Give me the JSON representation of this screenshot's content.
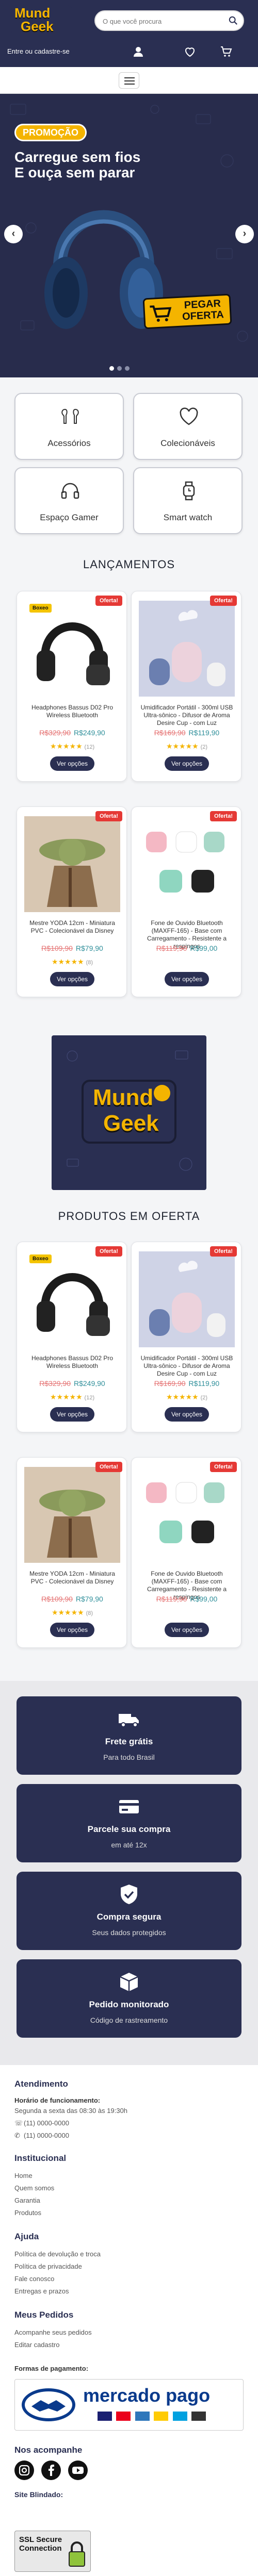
{
  "header": {
    "logo": {
      "line1": "Mund",
      "line2": "Geek"
    },
    "search_placeholder": "O que você procura",
    "login_text": "Entre ou cadastre-se",
    "icons": [
      "user-icon",
      "heart-icon",
      "cart-icon"
    ]
  },
  "banner": {
    "promo": "PROMOÇÃO",
    "title_line1": "Carregue sem fios",
    "title_line2": "E ouça sem parar",
    "cta": "PEGAR OFERTA",
    "prev": "‹",
    "next": "›",
    "dots": 3,
    "active_dot": 0
  },
  "categories": [
    {
      "label": "Acessórios",
      "icon": "earbuds-icon"
    },
    {
      "label": "Colecionáveis",
      "icon": "heart-icon"
    },
    {
      "label": "Espaço Gamer",
      "icon": "headset-icon"
    },
    {
      "label": "Smart watch",
      "icon": "watch-icon"
    }
  ],
  "launches_title": "LANÇAMENTOS",
  "offers_title": "PRODUTOS EM OFERTA",
  "promo_logo": {
    "line1": "Mund",
    "line2": "Geek"
  },
  "products": [
    {
      "name": "Headphones Bassus D02 Pro Wireless Bluetooth",
      "old": "R$329,90",
      "price": "R$249,90",
      "stars": "★★★★★",
      "reviews": "(12)",
      "badge_left": "Boxeo",
      "badge": "Oferta!",
      "img": "headphone"
    },
    {
      "name": "Umidificador Portátil - 300ml USB Ultra-sônico - Difusor de Aroma Desire Cup - com Luz",
      "old": "R$169,90",
      "price": "R$119,90",
      "stars": "★★★★★",
      "reviews": "(2)",
      "badge": "Oferta!",
      "img": "humidifier"
    },
    {
      "name": "Mestre YODA 12cm - Miniatura PVC - Colecionável da Disney",
      "old": "R$109,90",
      "price": "R$79,90",
      "stars": "★★★★★",
      "reviews": "(8)",
      "badge": "Oferta!",
      "img": "yoda"
    },
    {
      "name": "Fone de Ouvido Bluetooth (MAXFF-165) - Base com Carregamento - Resistente a respingos",
      "old": "R$119,90",
      "price": "R$99,00",
      "stars": "",
      "reviews": "",
      "badge": "Oferta!",
      "img": "earbuds"
    }
  ],
  "view_options": "Ver opções",
  "features": [
    {
      "title": "Frete grátis",
      "sub": "Para todo Brasil",
      "icon": "truck-icon"
    },
    {
      "title": "Parcele sua compra",
      "sub": "em até 12x",
      "icon": "card-icon"
    },
    {
      "title": "Compra segura",
      "sub": "Seus dados protegidos",
      "icon": "shield-icon"
    },
    {
      "title": "Pedido monitorado",
      "sub": "Código de rastreamento",
      "icon": "box-icon"
    }
  ],
  "footer": {
    "atendimento": "Atendimento",
    "horario_label": "Horário de funcionamento:",
    "horario": "Segunda a sexta das 08:30 às 19:30h",
    "phone1": "(11) 0000-0000",
    "phone2": "(11) 0000-0000",
    "institucional": "Institucional",
    "inst_items": [
      "Home",
      "Quem somos",
      "Garantia",
      "Produtos"
    ],
    "ajuda": "Ajuda",
    "ajuda_items": [
      "Política de devolução e troca",
      "Política de privacidade",
      "Fale conosco",
      "Entregas e prazos"
    ],
    "pedidos": "Meus Pedidos",
    "pedidos_items": [
      "Acompanhe seus pedidos",
      "Editar cadastro"
    ],
    "pagamento": "Formas de pagamento:",
    "mp_text": "mercado pago",
    "social_title": "Nos acompanhe",
    "blindado": "Site Blindado:",
    "ssl": "SSL Secure Connection"
  }
}
